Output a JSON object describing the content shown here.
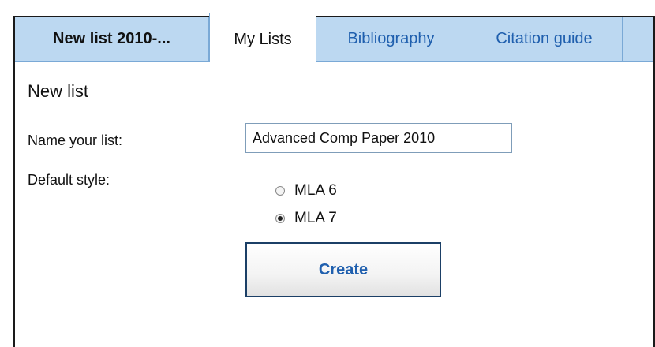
{
  "tabs": {
    "current_list": "New list 2010-...",
    "my_lists": "My Lists",
    "bibliography": "Bibliography",
    "citation_guide": "Citation guide"
  },
  "form": {
    "heading": "New list",
    "name_label": "Name your list:",
    "name_value": "Advanced Comp Paper 2010",
    "style_label": "Default style:",
    "style_options": [
      {
        "label": "MLA 6",
        "checked": false
      },
      {
        "label": "MLA 7",
        "checked": true
      }
    ],
    "create_label": "Create"
  },
  "colors": {
    "tab_background": "#bcd8f1",
    "link_blue": "#1f5fae",
    "button_border": "#1b3f66"
  }
}
